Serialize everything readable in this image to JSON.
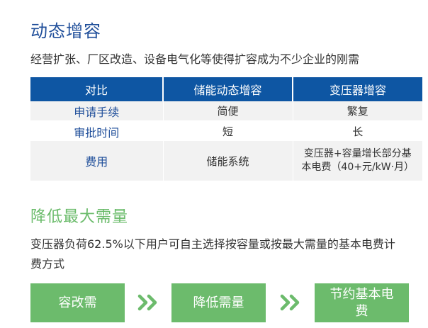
{
  "section1": {
    "title": "动态增容",
    "subtitle": "经营扩张、厂区改造、设备电气化等使得扩容成为不少企业的刚需"
  },
  "table": {
    "headers": [
      "对比",
      "储能动态增容",
      "变压器增容"
    ],
    "rows": [
      {
        "label": "申请手续",
        "col1": "简便",
        "col2": "繁复"
      },
      {
        "label": "审批时间",
        "col1": "短",
        "col2": "长"
      },
      {
        "label": "费用",
        "col1": "储能系统",
        "col2_line1": "变压器+容量增长部分基",
        "col2_line2": "本电费（40+元/kW·月）"
      }
    ]
  },
  "section2": {
    "title": "降低最大需量",
    "subtitle_line1": "变压器负荷62.5%以下用户可自主选择按容量或按最大需量的基本电费计",
    "subtitle_line2": "费方式"
  },
  "flow": {
    "step1": "容改需",
    "step2": "降低需量",
    "step3_line1": "节约基本电",
    "step3_line2": "费",
    "arrow_icon": "double-chevron-right-icon"
  },
  "colors": {
    "blue_title": "#1f4e9a",
    "table_header": "#0e56a3",
    "green": "#6cbb6c",
    "row_gray": "#f2f2f2"
  }
}
